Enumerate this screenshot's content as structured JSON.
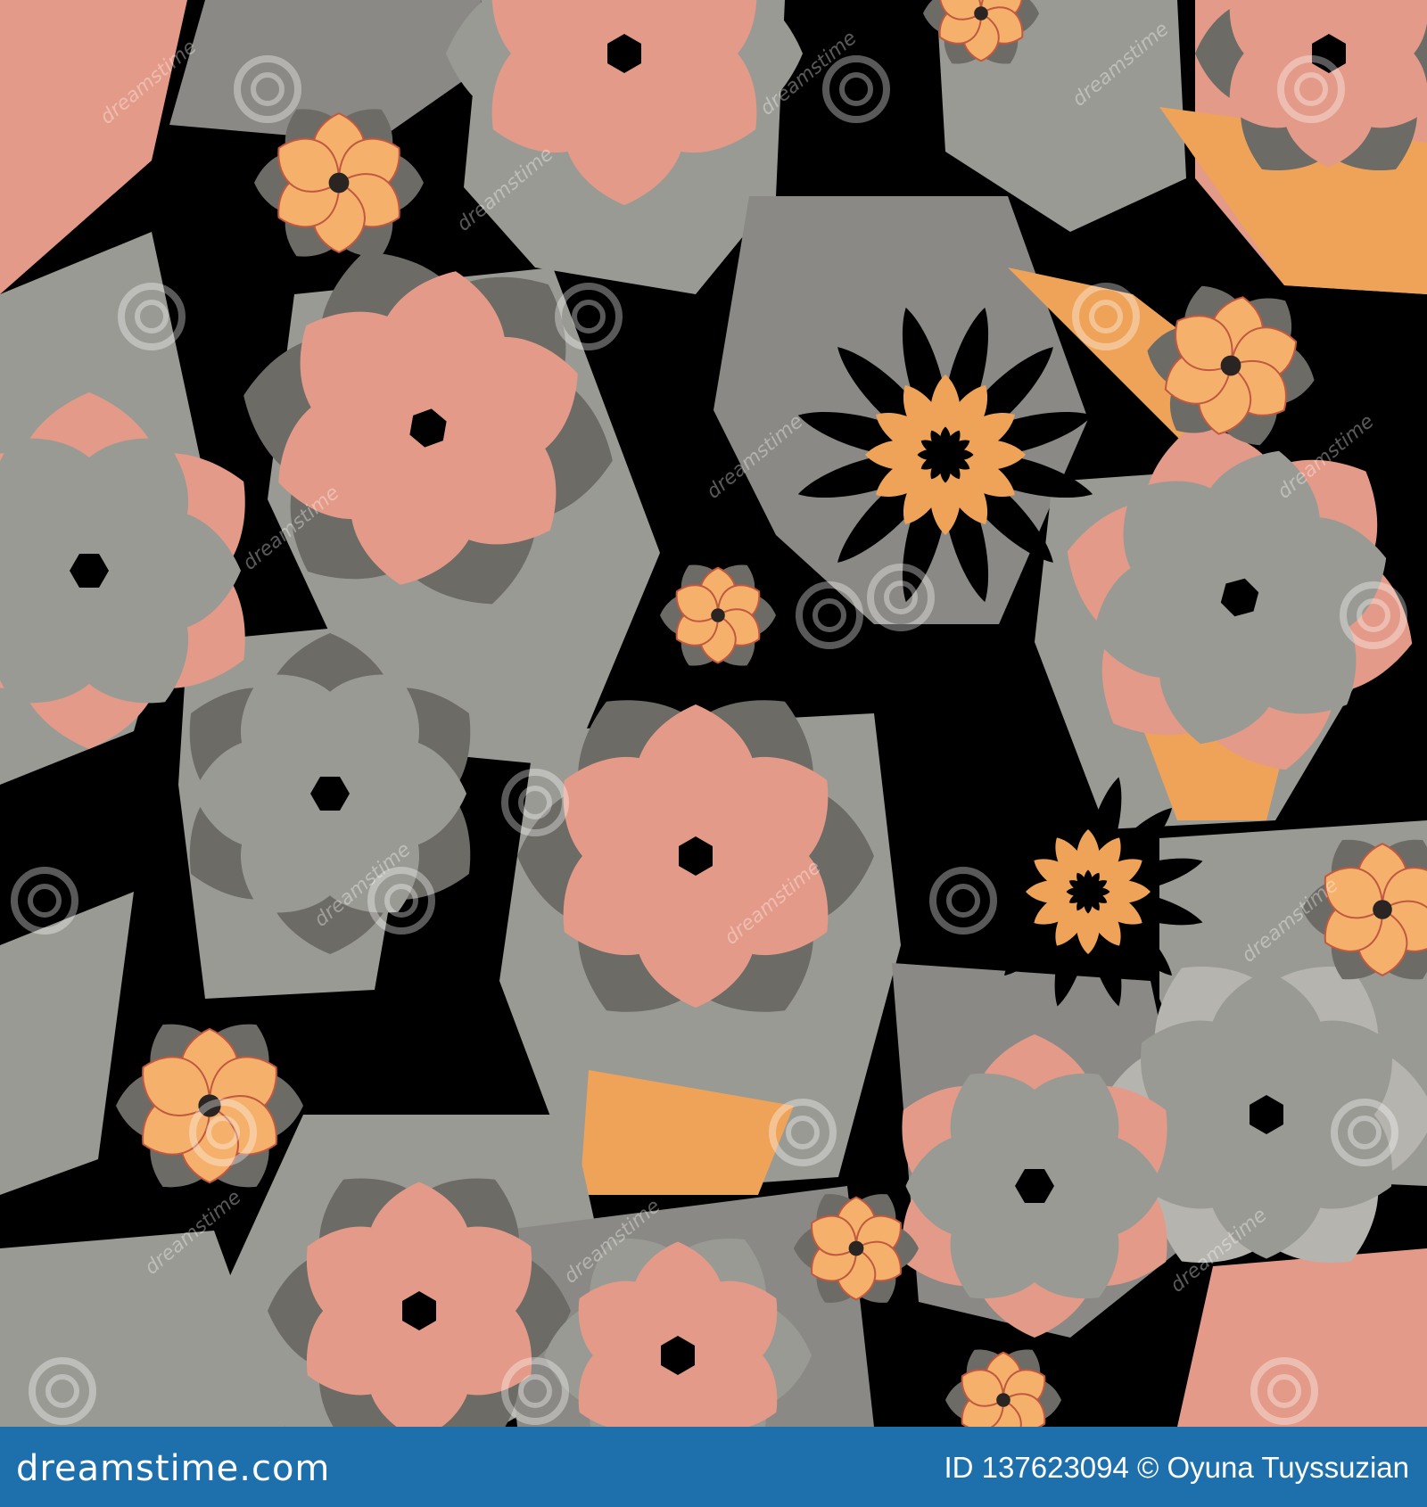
{
  "image": {
    "subject": "seamless floral pattern",
    "palette": {
      "background": "#000000",
      "salmon": "#e49a88",
      "grey": "#9a9a94",
      "dark_grey": "#6c6b66",
      "orange": "#eea359",
      "light_orange": "#f5b06c",
      "blue_line": "#2a6fa9"
    }
  },
  "watermark": {
    "text": "dreamstime"
  },
  "footer": {
    "logo_text": "dreamstime.com",
    "credit_text": "ID 137623094 © Oyuna Tuyssuzian",
    "background_color": "#1e70ac"
  }
}
